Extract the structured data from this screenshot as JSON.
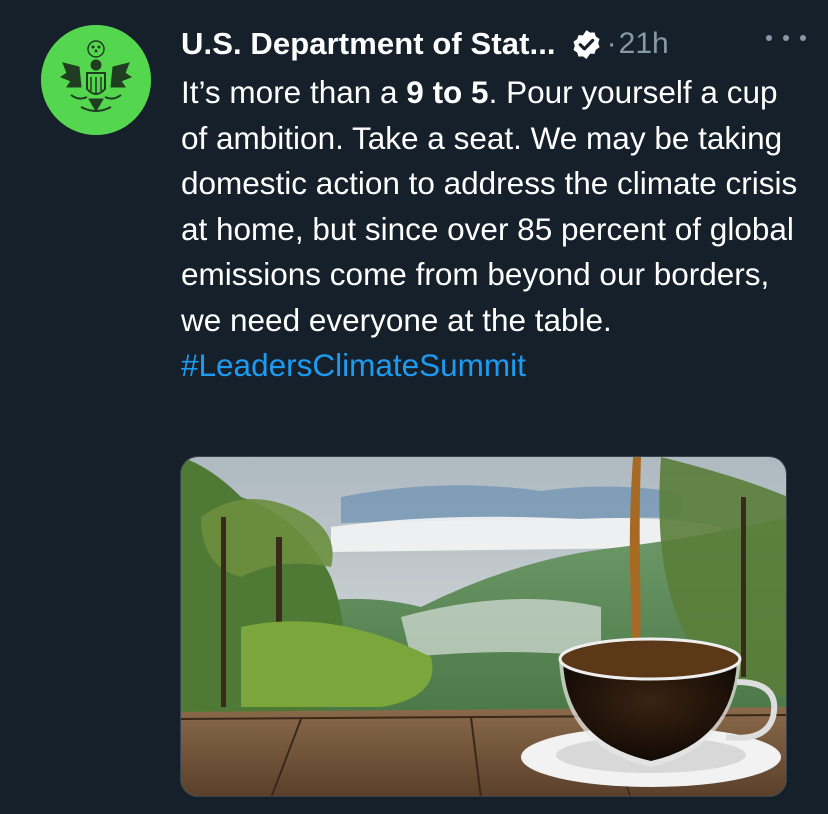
{
  "author": {
    "display_name": "U.S. Department of Stat...",
    "verified": true,
    "avatar_icon": "great-seal-icon",
    "avatar_bg": "#54d64f"
  },
  "meta": {
    "separator": "·",
    "timestamp": "21h",
    "more_icon": "more-dots-icon"
  },
  "tweet": {
    "text_1": "It’s more than a ",
    "text_bold": "9 to 5",
    "text_2": ". Pour yourself a cup of ambition. Take a seat. We may be taking domestic action to address the climate crisis at home, but since over 85 percent of global emissions come from beyond our borders, we need everyone at the table. ",
    "hashtag": "#LeadersClimateSummit"
  },
  "media": {
    "icon": "coffee-cup-forest-photo"
  },
  "colors": {
    "background": "#15202b",
    "text": "#ffffff",
    "secondary": "#8899a6",
    "link": "#1d9bf0"
  }
}
